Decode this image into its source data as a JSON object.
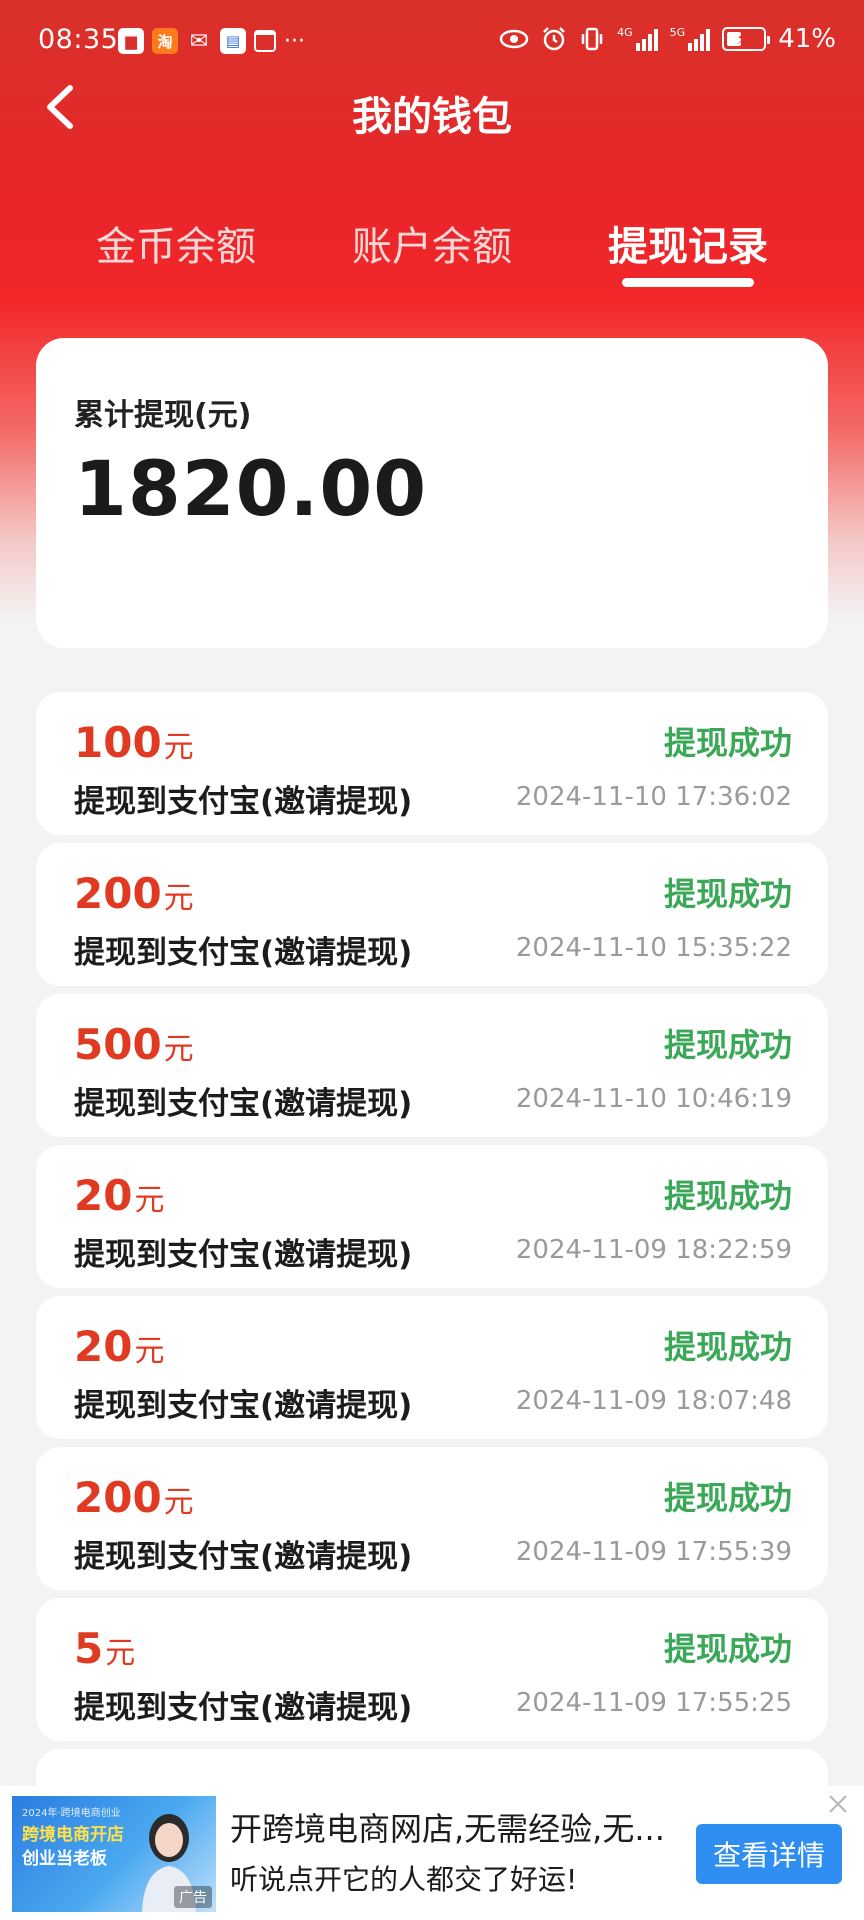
{
  "status_bar": {
    "time": "08:35",
    "battery_percent": "41%",
    "battery_level": 0.41,
    "network_1": "4G",
    "network_2": "5G",
    "more": "···",
    "icons": [
      "notification-app-icon",
      "taobao-icon",
      "wechat-icon",
      "document-icon",
      "calendar-icon",
      "eye-icon",
      "alarm-icon",
      "vibrate-icon",
      "signal-icon",
      "battery-icon"
    ]
  },
  "header": {
    "title": "我的钱包",
    "back_icon": "chevron-left-icon"
  },
  "tabs": [
    {
      "label": "金币余额",
      "active": false
    },
    {
      "label": "账户余额",
      "active": false
    },
    {
      "label": "提现记录",
      "active": true
    }
  ],
  "summary": {
    "label": "累计提现(元)",
    "value": "1820.00"
  },
  "records": [
    {
      "amount": "100",
      "unit": "元",
      "status": "提现成功",
      "desc": "提现到支付宝(邀请提现)",
      "time": "2024-11-10 17:36:02"
    },
    {
      "amount": "200",
      "unit": "元",
      "status": "提现成功",
      "desc": "提现到支付宝(邀请提现)",
      "time": "2024-11-10 15:35:22"
    },
    {
      "amount": "500",
      "unit": "元",
      "status": "提现成功",
      "desc": "提现到支付宝(邀请提现)",
      "time": "2024-11-10 10:46:19"
    },
    {
      "amount": "20",
      "unit": "元",
      "status": "提现成功",
      "desc": "提现到支付宝(邀请提现)",
      "time": "2024-11-09 18:22:59"
    },
    {
      "amount": "20",
      "unit": "元",
      "status": "提现成功",
      "desc": "提现到支付宝(邀请提现)",
      "time": "2024-11-09 18:07:48"
    },
    {
      "amount": "200",
      "unit": "元",
      "status": "提现成功",
      "desc": "提现到支付宝(邀请提现)",
      "time": "2024-11-09 17:55:39"
    },
    {
      "amount": "5",
      "unit": "元",
      "status": "提现成功",
      "desc": "提现到支付宝(邀请提现)",
      "time": "2024-11-09 17:55:25"
    }
  ],
  "ad": {
    "image_line1": "2024年·跨境电商创业",
    "image_line2": "跨境电商开店",
    "image_line3": "创业当老板",
    "image_tag": "广告",
    "title": "开跨境电商网店,无需经验,无...",
    "subtitle": "听说点开它的人都交了好运!",
    "button": "查看详情",
    "close_icon": "close-icon"
  },
  "colors": {
    "header_red": "#e8262a",
    "amount_red": "#e03a22",
    "success_green": "#3aa857",
    "ad_button_blue": "#2f8ef2"
  }
}
